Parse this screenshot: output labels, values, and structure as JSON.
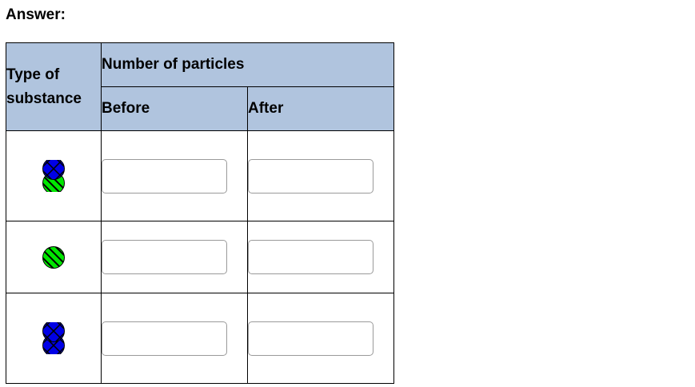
{
  "answer_label": "Answer:",
  "table": {
    "header_type": "Type of substance",
    "header_number": "Number of particles",
    "header_before": "Before",
    "header_after": "After",
    "rows": [
      {
        "icon": "blue-green-diatomic-particle-icon",
        "before_value": "",
        "after_value": ""
      },
      {
        "icon": "green-single-particle-icon",
        "before_value": "",
        "after_value": ""
      },
      {
        "icon": "blue-blue-diatomic-particle-icon",
        "before_value": "",
        "after_value": ""
      }
    ]
  },
  "colors": {
    "header_bg": "#b0c4de",
    "blue_particle": "#0000e6",
    "green_particle": "#00e600"
  }
}
